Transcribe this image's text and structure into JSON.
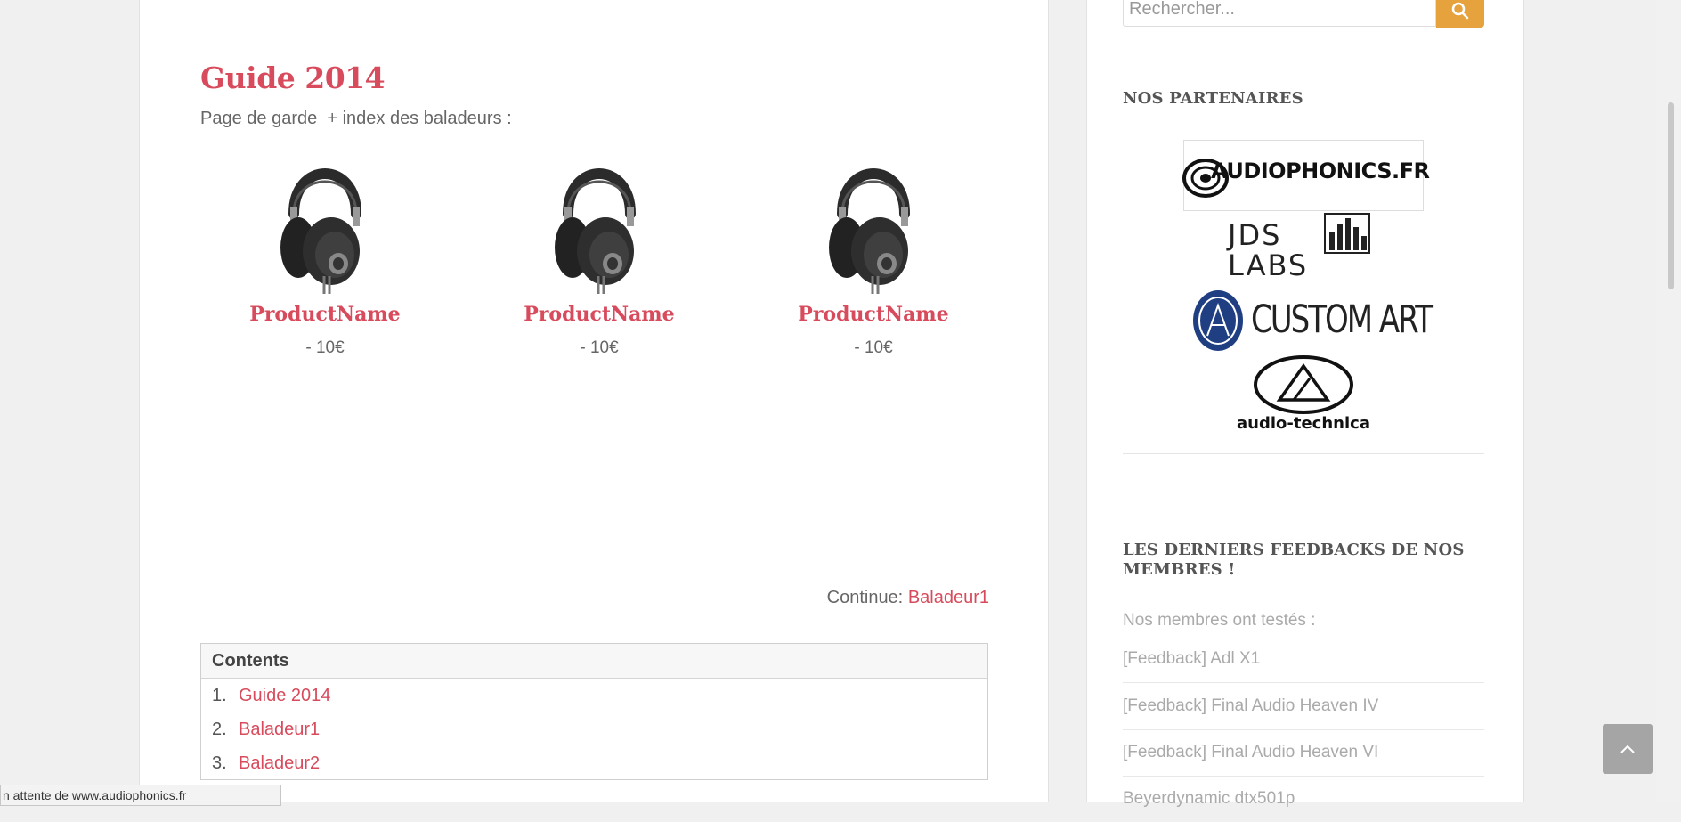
{
  "article": {
    "title": "Guide 2014",
    "subtitle": "Page de garde  + index des baladeurs :",
    "products": [
      {
        "name": "ProductName",
        "price": "- 10€"
      },
      {
        "name": "ProductName",
        "price": "- 10€"
      },
      {
        "name": "ProductName",
        "price": "- 10€"
      }
    ],
    "continue_label": "Continue:",
    "continue_link": "Baladeur1",
    "toc": {
      "heading": "Contents",
      "items": [
        {
          "num": "1.",
          "label": "Guide 2014"
        },
        {
          "num": "2.",
          "label": "Baladeur1"
        },
        {
          "num": "3.",
          "label": "Baladeur2"
        }
      ]
    }
  },
  "sidebar": {
    "search_placeholder": "Rechercher...",
    "partners_title": "NOS PARTENAIRES",
    "partners": [
      "AUDIOPHONICS.FR",
      "JDS LABS",
      "CUSTOM ART",
      "audio-technica"
    ],
    "feedback_title": "LES DERNIERS FEEDBACKS DE NOS MEMBRES !",
    "feedback_intro": "Nos membres ont testés :",
    "feedback_items": [
      "[Feedback] Adl X1",
      "[Feedback] Final Audio Heaven IV",
      "[Feedback] Final Audio Heaven VI",
      "Beyerdynamic dtx501p"
    ]
  },
  "status_bar": "n attente de www.audiophonics.fr",
  "colors": {
    "accent": "#d74b5c",
    "search_button": "#e6a23c",
    "back_to_top": "#a5a5a5"
  },
  "icons": [
    "headphones-icon",
    "search-icon",
    "chevron-up-icon"
  ]
}
